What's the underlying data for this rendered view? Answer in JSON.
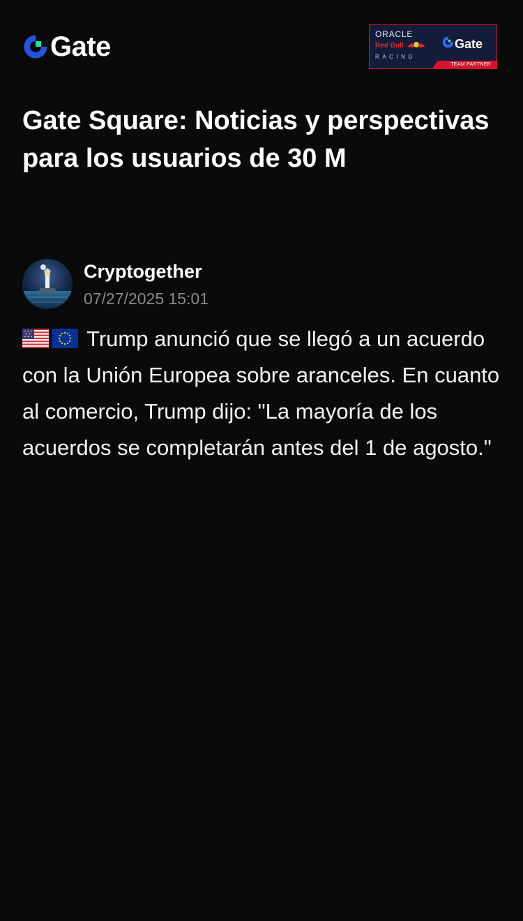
{
  "header": {
    "logo_text": "Gate",
    "logo_icon": "gate-logo-icon",
    "partner": {
      "oracle": "ORACLE",
      "red_bull": "Red Bull",
      "racing": "RACING",
      "gate_text": "Gate",
      "team_partner": "TEAM PARTNER"
    }
  },
  "article": {
    "title": "Gate Square: Noticias y perspectivas para los usuarios de 30 M"
  },
  "post": {
    "author": "Cryptogether",
    "timestamp": "07/27/2025 15:01",
    "flag_icons": [
      "us-flag-icon",
      "eu-flag-icon"
    ],
    "text": "Trump anunció que se llegó a un acuerdo con la Unión Europea sobre aranceles. En cuanto al comercio, Trump dijo: \"La mayoría de los acuerdos se completarán antes del 1 de agosto.\""
  },
  "colors": {
    "background": "#0a0a0a",
    "brand_blue": "#2354e6",
    "brand_green": "#17e6a1",
    "timestamp_gray": "#8a8a8a",
    "partner_red": "#d6132a",
    "partner_navy": "#131c3a"
  }
}
